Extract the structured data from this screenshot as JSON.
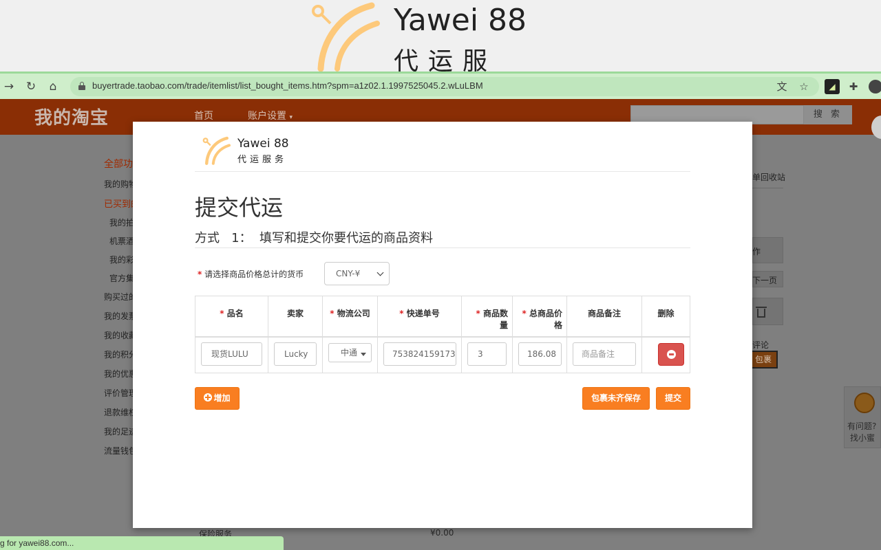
{
  "banner": {
    "brand": "Yawei 88",
    "sub": "代运服务",
    "colors": {
      "logo_accent": "#fdc97b",
      "text": "#222222"
    }
  },
  "browser": {
    "url": "buyertrade.taobao.com/trade/itemlist/list_bought_items.htm?spm=a1z02.1.1997525045.2.wLuLBM",
    "status_text": "g for yawei88.com...",
    "icons": [
      "forward-icon",
      "reload-icon",
      "home-icon",
      "lock-icon",
      "translate-icon",
      "star-icon",
      "extension-icon",
      "puzzle-icon",
      "profile-icon"
    ]
  },
  "taobao": {
    "logo": "我的淘宝",
    "nav": [
      "首页",
      "账户设置"
    ],
    "search_button": "搜 索",
    "sidebar": [
      "全部功",
      "我的购物",
      "已买到的",
      "我的拍",
      "机票酒",
      "我的彩",
      "官方集",
      "购买过的",
      "我的发票",
      "我的收藏",
      "我的积分",
      "我的优惠",
      "评价管理",
      "退款维权",
      "我的足迹",
      "流量钱包"
    ],
    "right_labels": [
      "单回收站",
      "作",
      "下一页",
      "评论",
      "包裹"
    ],
    "helper": [
      "有问题?",
      "找小蜜"
    ],
    "insurance_label": "保险服务",
    "insurance_value": "¥0.00",
    "colors": {
      "header": "#8a2e05"
    }
  },
  "modal": {
    "brand": "Yawei 88",
    "sub": "代运服务",
    "title": "提交代运",
    "subtitle": "方式   1：  填写和提交你要代运的商品资料",
    "required_mark": "*",
    "currency_label": "请选择商品价格总计的货币",
    "currency_value": "CNY-¥",
    "columns": {
      "name": "品名",
      "seller": "卖家",
      "logistics": "物流公司",
      "tracking": "快递单号",
      "qty_line1": "商品数",
      "qty_line2": "量",
      "total_line1": "总商品价",
      "total_line2": "格",
      "remark": "商品备注",
      "delete": "删除"
    },
    "row": {
      "name": "现货LULU",
      "seller": "Lucky",
      "logistics": "中通",
      "tracking": "753824159173",
      "qty": "3",
      "total": "186.08",
      "remark_placeholder": "商品备注"
    },
    "buttons": {
      "add": "增加",
      "save_incomplete": "包裹未齐保存",
      "submit": "提交"
    },
    "colors": {
      "primary": "#f97e21",
      "danger": "#d9534f",
      "required": "#dd2222"
    }
  }
}
